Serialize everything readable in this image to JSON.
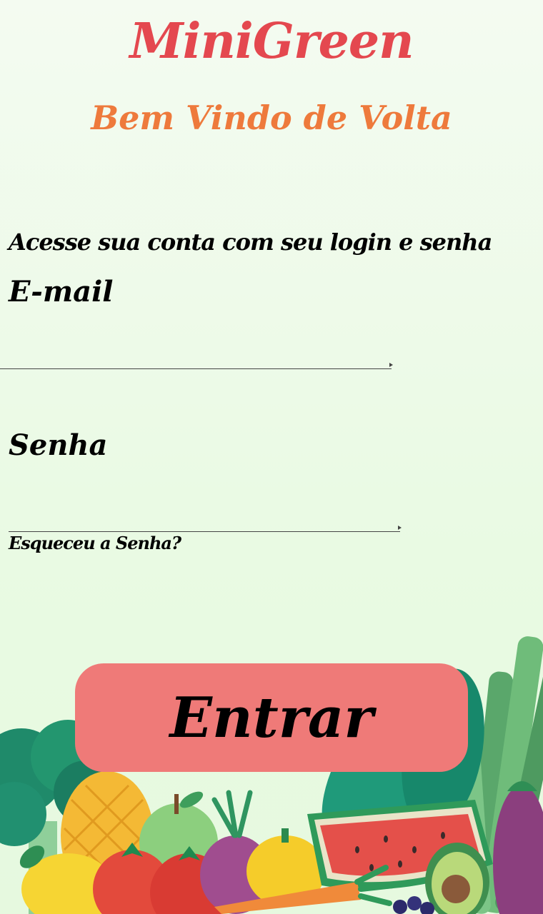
{
  "header": {
    "app_title": "MiniGreen",
    "subtitle": "Bem Vindo de Volta"
  },
  "login_form": {
    "instructions": "Acesse sua conta com seu login e senha",
    "email_label": "E-mail",
    "email_value": "",
    "password_label": "Senha",
    "password_value": "",
    "forgot_password": "Esqueceu a Senha?",
    "submit_label": "Entrar"
  },
  "colors": {
    "title": "#e4484f",
    "subtitle": "#ee7a3c",
    "button": "#ef7a78",
    "background": "#e9fae3"
  },
  "illustration": {
    "icons": [
      "broccoli-icon",
      "pineapple-icon",
      "lemon-icon",
      "apple-icon",
      "tomato-icon",
      "onion-icon",
      "bell-pepper-icon",
      "watermelon-icon",
      "carrot-icon",
      "avocado-icon",
      "eggplant-icon",
      "celery-icon",
      "blueberry-icon"
    ]
  }
}
